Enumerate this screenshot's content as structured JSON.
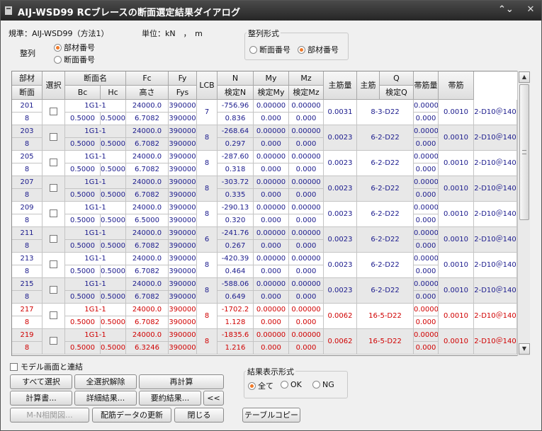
{
  "window": {
    "title": "AIJ-WSD99 RCブレースの断面選定結果ダイアログ",
    "close": "✕",
    "menu": "⌃⌄"
  },
  "info": {
    "spec_label": "規準：AIJ-WSD99（方法1）",
    "unit_label": "単位：kN　，　m"
  },
  "sort": {
    "label": "整列",
    "options": [
      {
        "label": "部材番号",
        "selected": true
      },
      {
        "label": "断面番号",
        "selected": false
      }
    ]
  },
  "align_format": {
    "title": "整列形式",
    "options": [
      {
        "label": "断面番号",
        "selected": false
      },
      {
        "label": "部材番号",
        "selected": true
      }
    ]
  },
  "headers": {
    "member": "部材",
    "section": "断面",
    "select": "選択",
    "section_name": "断面名",
    "bc": "Bc",
    "hc": "Hc",
    "fc": "Fc",
    "height": "高さ",
    "fy": "Fy",
    "fys": "Fys",
    "lcb": "LCB",
    "n": "N",
    "check_n": "検定N",
    "my": "My",
    "check_my": "検定My",
    "mz": "Mz",
    "check_mz": "検定Mz",
    "main_ratio": "主筋量",
    "main": "主筋",
    "q": "Q",
    "check_q": "検定Q",
    "hoop_ratio": "帯筋量",
    "hoop": "帯筋"
  },
  "rows": [
    {
      "member": "201",
      "section": "8",
      "secname": "1G1-1",
      "bc": "0.5000",
      "hc": "0.5000",
      "fc": "24000.0",
      "height": "6.7082",
      "fy": "390000",
      "fys": "390000",
      "lcb": "7",
      "n": "-756.96",
      "cn": "0.836",
      "my": "0.00000",
      "cmy": "0.000",
      "mz": "0.00000",
      "cmz": "0.000",
      "mratio": "0.0031",
      "main": "8-3-D22",
      "q": "0.00000",
      "cq": "0.000",
      "hratio": "0.0010",
      "hoop": "2-D10＠140",
      "ng": false
    },
    {
      "member": "203",
      "section": "8",
      "secname": "1G1-1",
      "bc": "0.5000",
      "hc": "0.5000",
      "fc": "24000.0",
      "height": "6.7082",
      "fy": "390000",
      "fys": "390000",
      "lcb": "8",
      "n": "-268.64",
      "cn": "0.297",
      "my": "0.00000",
      "cmy": "0.000",
      "mz": "0.00000",
      "cmz": "0.000",
      "mratio": "0.0023",
      "main": "6-2-D22",
      "q": "0.00000",
      "cq": "0.000",
      "hratio": "0.0010",
      "hoop": "2-D10＠140",
      "ng": false
    },
    {
      "member": "205",
      "section": "8",
      "secname": "1G1-1",
      "bc": "0.5000",
      "hc": "0.5000",
      "fc": "24000.0",
      "height": "6.7082",
      "fy": "390000",
      "fys": "390000",
      "lcb": "8",
      "n": "-287.60",
      "cn": "0.318",
      "my": "0.00000",
      "cmy": "0.000",
      "mz": "0.00000",
      "cmz": "0.000",
      "mratio": "0.0023",
      "main": "6-2-D22",
      "q": "0.00000",
      "cq": "0.000",
      "hratio": "0.0010",
      "hoop": "2-D10＠140",
      "ng": false
    },
    {
      "member": "207",
      "section": "8",
      "secname": "1G1-1",
      "bc": "0.5000",
      "hc": "0.5000",
      "fc": "24000.0",
      "height": "6.7082",
      "fy": "390000",
      "fys": "390000",
      "lcb": "8",
      "n": "-303.72",
      "cn": "0.335",
      "my": "0.00000",
      "cmy": "0.000",
      "mz": "0.00000",
      "cmz": "0.000",
      "mratio": "0.0023",
      "main": "6-2-D22",
      "q": "0.00000",
      "cq": "0.000",
      "hratio": "0.0010",
      "hoop": "2-D10＠140",
      "ng": false
    },
    {
      "member": "209",
      "section": "8",
      "secname": "1G1-1",
      "bc": "0.5000",
      "hc": "0.5000",
      "fc": "24000.0",
      "height": "6.5000",
      "fy": "390000",
      "fys": "390000",
      "lcb": "8",
      "n": "-290.13",
      "cn": "0.320",
      "my": "0.00000",
      "cmy": "0.000",
      "mz": "0.00000",
      "cmz": "0.000",
      "mratio": "0.0023",
      "main": "6-2-D22",
      "q": "0.00000",
      "cq": "0.000",
      "hratio": "0.0010",
      "hoop": "2-D10＠140",
      "ng": false
    },
    {
      "member": "211",
      "section": "8",
      "secname": "1G1-1",
      "bc": "0.5000",
      "hc": "0.5000",
      "fc": "24000.0",
      "height": "6.7082",
      "fy": "390000",
      "fys": "390000",
      "lcb": "6",
      "n": "-241.76",
      "cn": "0.267",
      "my": "0.00000",
      "cmy": "0.000",
      "mz": "0.00000",
      "cmz": "0.000",
      "mratio": "0.0023",
      "main": "6-2-D22",
      "q": "0.00000",
      "cq": "0.000",
      "hratio": "0.0010",
      "hoop": "2-D10＠140",
      "ng": false
    },
    {
      "member": "213",
      "section": "8",
      "secname": "1G1-1",
      "bc": "0.5000",
      "hc": "0.5000",
      "fc": "24000.0",
      "height": "6.7082",
      "fy": "390000",
      "fys": "390000",
      "lcb": "8",
      "n": "-420.39",
      "cn": "0.464",
      "my": "0.00000",
      "cmy": "0.000",
      "mz": "0.00000",
      "cmz": "0.000",
      "mratio": "0.0023",
      "main": "6-2-D22",
      "q": "0.00000",
      "cq": "0.000",
      "hratio": "0.0010",
      "hoop": "2-D10＠140",
      "ng": false
    },
    {
      "member": "215",
      "section": "8",
      "secname": "1G1-1",
      "bc": "0.5000",
      "hc": "0.5000",
      "fc": "24000.0",
      "height": "6.7082",
      "fy": "390000",
      "fys": "390000",
      "lcb": "8",
      "n": "-588.06",
      "cn": "0.649",
      "my": "0.00000",
      "cmy": "0.000",
      "mz": "0.00000",
      "cmz": "0.000",
      "mratio": "0.0023",
      "main": "6-2-D22",
      "q": "0.00000",
      "cq": "0.000",
      "hratio": "0.0010",
      "hoop": "2-D10＠140",
      "ng": false
    },
    {
      "member": "217",
      "section": "8",
      "secname": "1G1-1",
      "bc": "0.5000",
      "hc": "0.5000",
      "fc": "24000.0",
      "height": "6.7082",
      "fy": "390000",
      "fys": "390000",
      "lcb": "8",
      "n": "-1702.2",
      "cn": "1.128",
      "my": "0.00000",
      "cmy": "0.000",
      "mz": "0.00000",
      "cmz": "0.000",
      "mratio": "0.0062",
      "main": "16-5-D22",
      "q": "0.00000",
      "cq": "0.000",
      "hratio": "0.0010",
      "hoop": "2-D10＠140",
      "ng": true
    },
    {
      "member": "219",
      "section": "8",
      "secname": "1G1-1",
      "bc": "0.5000",
      "hc": "0.5000",
      "fc": "24000.0",
      "height": "6.3246",
      "fy": "390000",
      "fys": "390000",
      "lcb": "8",
      "n": "-1835.6",
      "cn": "1.216",
      "my": "0.00000",
      "cmy": "0.000",
      "mz": "0.00000",
      "cmz": "0.000",
      "mratio": "0.0062",
      "main": "16-5-D22",
      "q": "0.00000",
      "cq": "0.000",
      "hratio": "0.0010",
      "hoop": "2-D10＠140",
      "ng": true
    }
  ],
  "link_model": {
    "label": "モデル画面と連結",
    "checked": false
  },
  "result_format": {
    "title": "結果表示形式",
    "options": [
      {
        "label": "全て",
        "selected": true
      },
      {
        "label": "OK",
        "selected": false
      },
      {
        "label": "NG",
        "selected": false
      }
    ]
  },
  "buttons": {
    "select_all": "すべて選択",
    "deselect_all": "全選択解除",
    "recalc": "再計算",
    "calc_report": "計算書...",
    "detail": "詳細結果...",
    "summary": "要約結果...",
    "collapse": "<<",
    "mn_chart": "M-N相関図...",
    "update_rebar": "配筋データの更新",
    "close": "閉じる",
    "copy_table": "テーブルコピー"
  },
  "colors": {
    "ng": "#d00000",
    "ok_text": "#1a1a8c",
    "row_alt": "#e8e8e8",
    "radio_on": "#f07a2a"
  }
}
